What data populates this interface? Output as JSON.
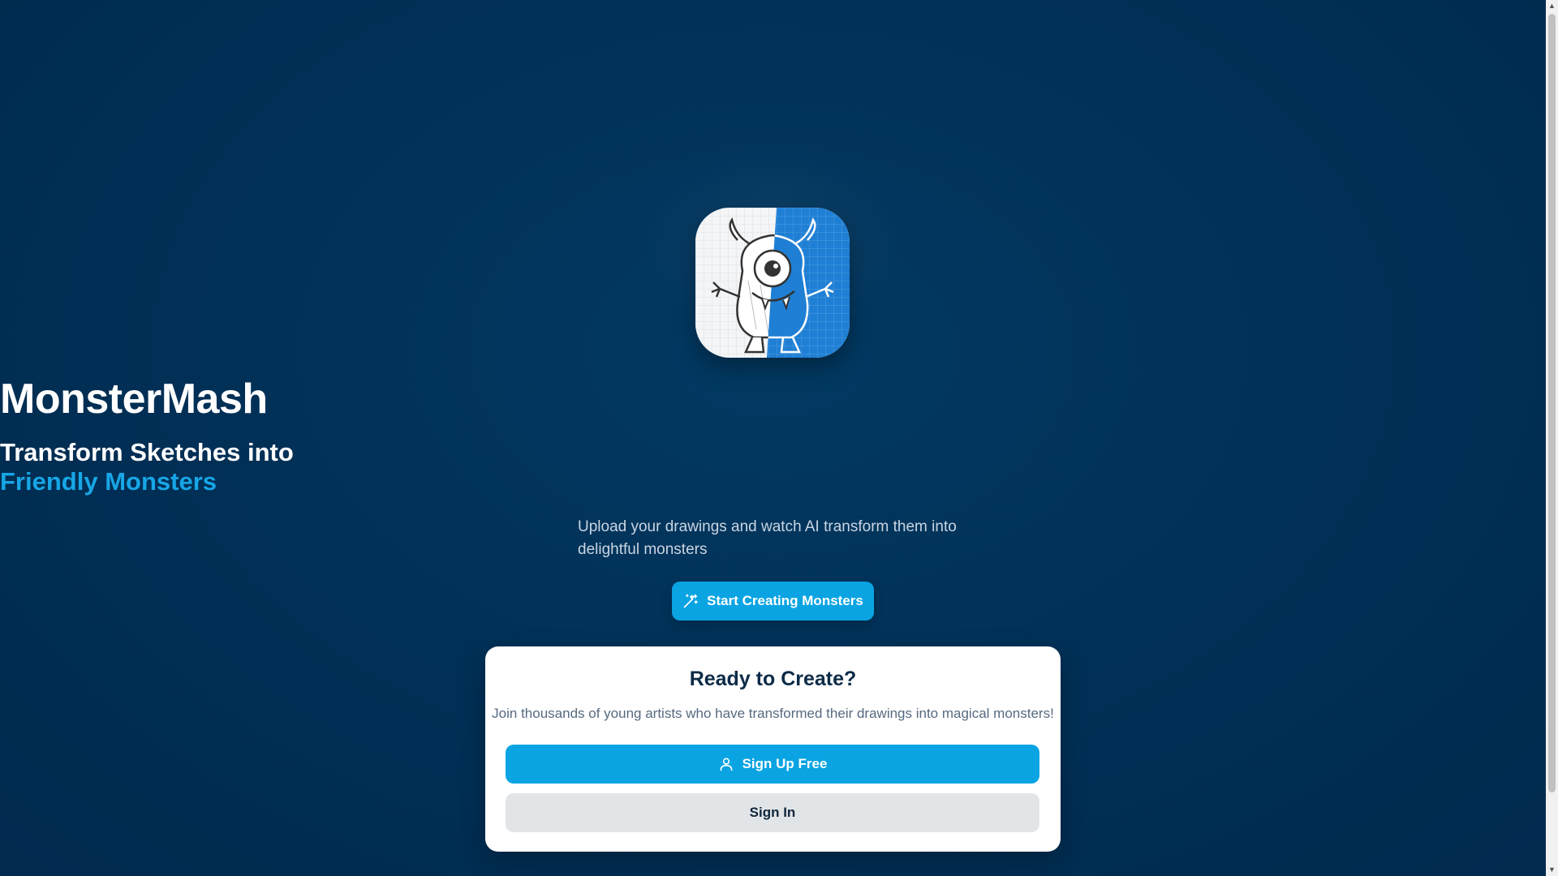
{
  "app": {
    "title": "MonsterMash",
    "logo_icon": "monster-sketch-logo-icon"
  },
  "hero": {
    "tagline_line1": "Transform Sketches into",
    "tagline_line2": "Friendly Monsters",
    "description": "Upload your drawings and watch AI transform them into delightful monsters",
    "cta_label": "Start Creating Monsters",
    "cta_icon": "magic-wand-icon"
  },
  "card": {
    "title": "Ready to Create?",
    "text": "Join thousands of young artists who have transformed their drawings into magical monsters!",
    "signup_label": "Sign Up Free",
    "signup_icon": "user-icon",
    "signin_label": "Sign In"
  },
  "colors": {
    "background": "#002d52",
    "accent": "#0aa4e3",
    "accent_text": "#17a6e6",
    "card_bg": "#ffffff",
    "secondary_button": "#e2e5e8"
  }
}
